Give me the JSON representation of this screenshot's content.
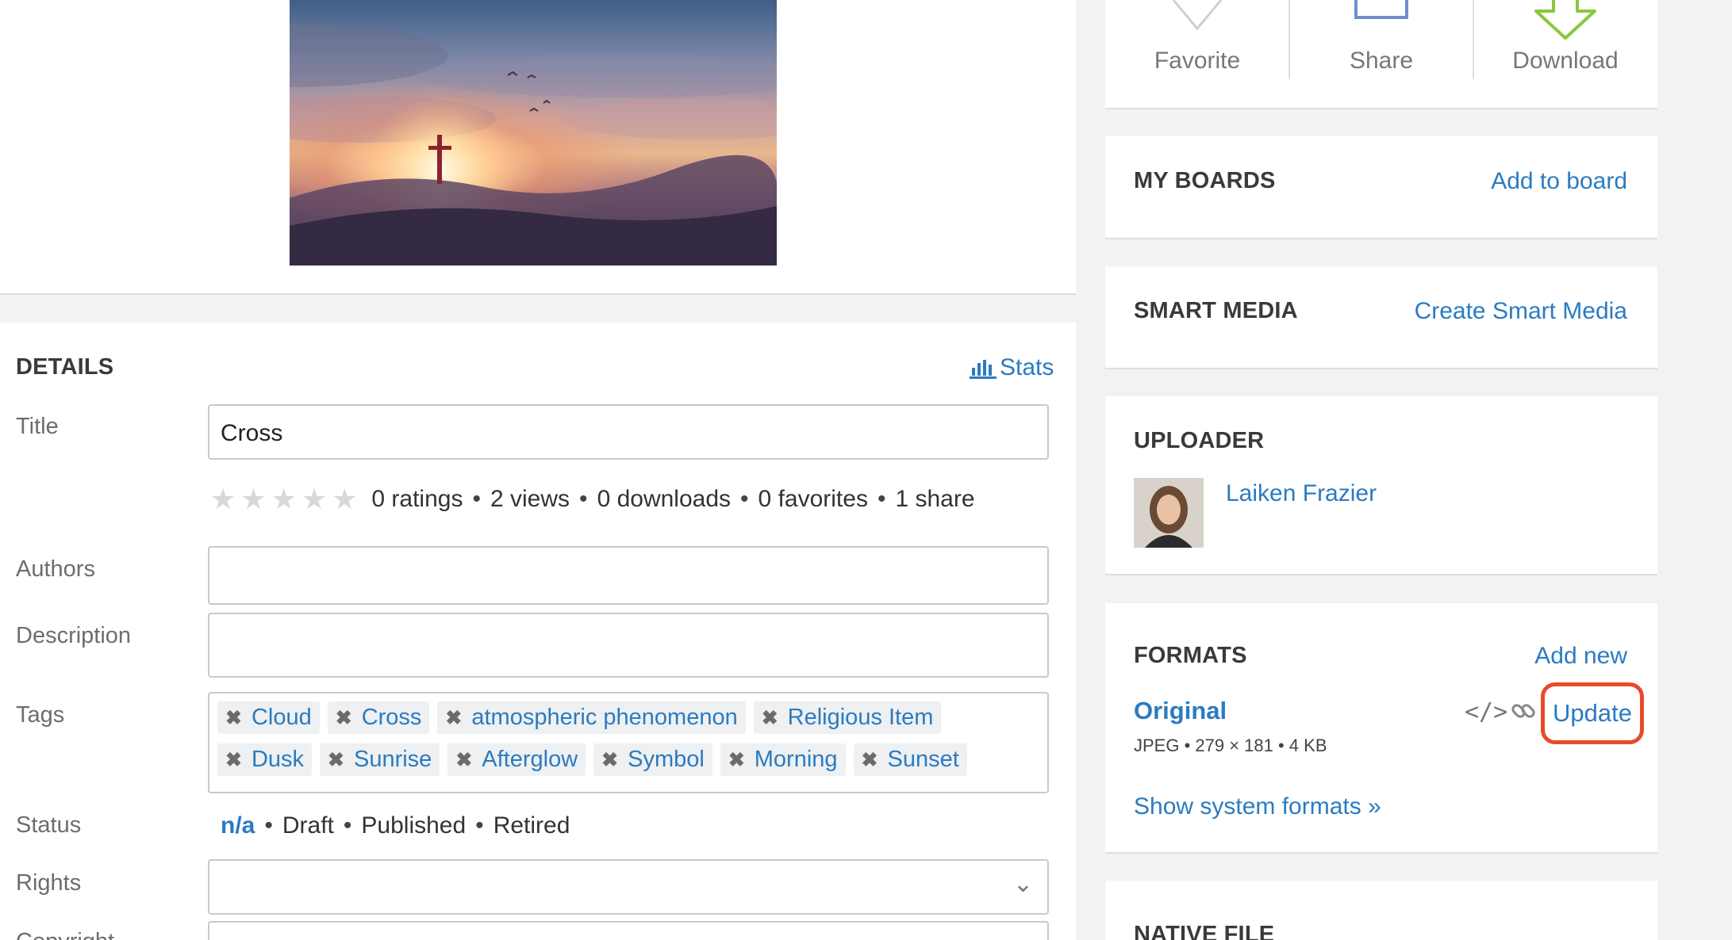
{
  "actions": {
    "favorite": "Favorite",
    "share": "Share",
    "download": "Download"
  },
  "boards": {
    "title": "MY BOARDS",
    "link": "Add to board"
  },
  "smart_media": {
    "title": "SMART MEDIA",
    "link": "Create Smart Media"
  },
  "uploader": {
    "title": "UPLOADER",
    "name": "Laiken Frazier"
  },
  "formats": {
    "title": "FORMATS",
    "add_new": "Add new",
    "original_name": "Original",
    "original_meta": "JPEG • 279 × 181 • 4 KB",
    "code_icon": "</>",
    "update": "Update",
    "show_system": "Show system formats »"
  },
  "native_file": {
    "title": "NATIVE FILE"
  },
  "details": {
    "title": "DETAILS",
    "stats_label": "Stats",
    "title_label": "Title",
    "title_value": "Cross",
    "ratings": {
      "ratings": "0 ratings",
      "views": "2 views",
      "downloads": "0 downloads",
      "favorites": "0 favorites",
      "shares": "1 share"
    },
    "authors_label": "Authors",
    "description_label": "Description",
    "tags_label": "Tags",
    "tags": [
      "Cloud",
      "Cross",
      "atmospheric phenomenon",
      "Religious Item",
      "Dusk",
      "Sunrise",
      "Afterglow",
      "Symbol",
      "Morning",
      "Sunset"
    ],
    "status_label": "Status",
    "status": {
      "na": "n/a",
      "draft": "Draft",
      "published": "Published",
      "retired": "Retired"
    },
    "rights_label": "Rights",
    "copyright_label": "Copyright"
  },
  "colors": {
    "link": "#2b7bc0",
    "highlight": "#e84a2e",
    "download_green": "#8cc63f",
    "share_blue": "#6f8fc9"
  }
}
